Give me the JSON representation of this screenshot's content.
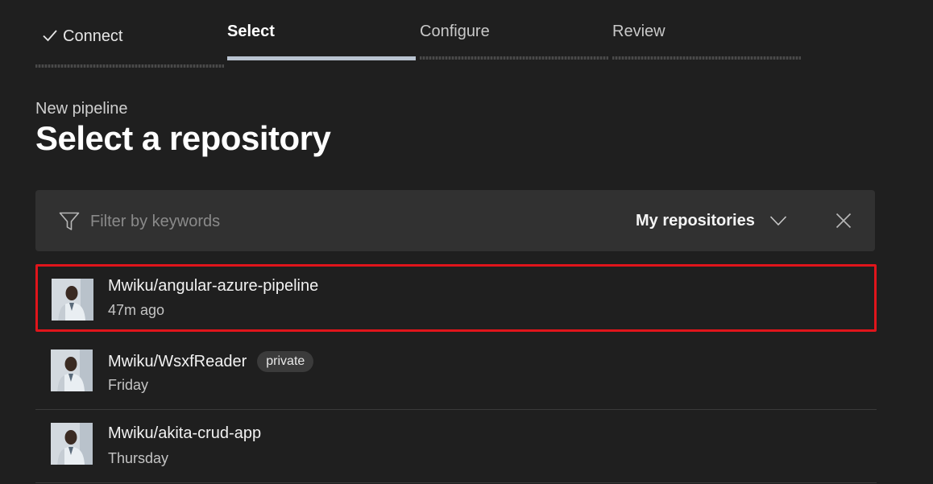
{
  "steps": [
    {
      "label": "Connect",
      "state": "completed"
    },
    {
      "label": "Select",
      "state": "active"
    },
    {
      "label": "Configure",
      "state": "pending"
    },
    {
      "label": "Review",
      "state": "pending"
    }
  ],
  "header": {
    "subtitle": "New pipeline",
    "title": "Select a repository"
  },
  "filter": {
    "placeholder": "Filter by keywords",
    "value": "",
    "scope_label": "My repositories",
    "icons": {
      "filter": "filter-icon",
      "dropdown": "chevron-down-icon",
      "clear": "close-icon"
    }
  },
  "repositories": [
    {
      "name": "Mwiku/angular-azure-pipeline",
      "time": "47m ago",
      "badge": "",
      "selected": true
    },
    {
      "name": "Mwiku/WsxfReader",
      "time": "Friday",
      "badge": "private",
      "selected": false
    },
    {
      "name": "Mwiku/akita-crud-app",
      "time": "Thursday",
      "badge": "",
      "selected": false
    }
  ],
  "colors": {
    "background": "#1f1f1f",
    "filter_bar": "#313131",
    "active_underline": "#b9c3d0",
    "selection_border": "#e0151b"
  }
}
